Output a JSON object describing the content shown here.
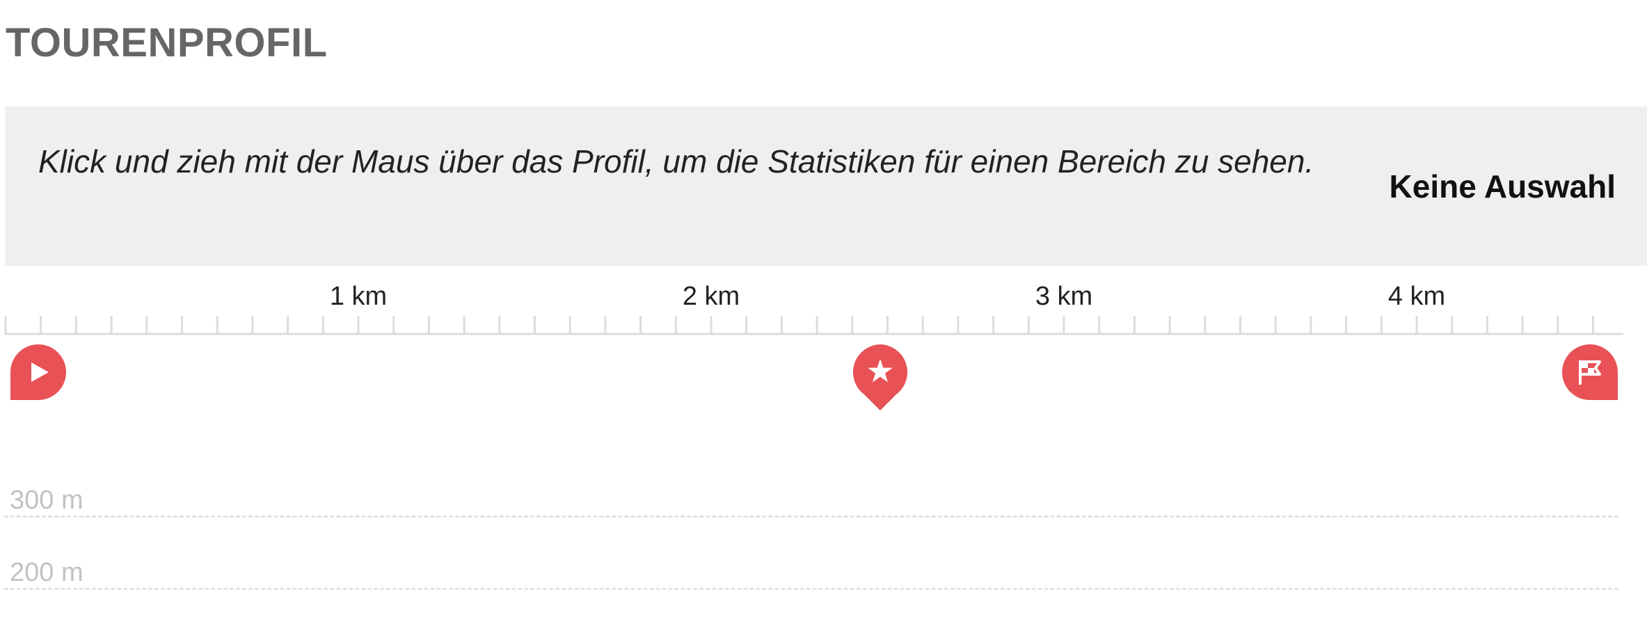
{
  "header": {
    "title": "TOURENPROFIL"
  },
  "info_box": {
    "hint": "Klick und zieh mit der Maus über das Profil, um die Statistiken für einen Bereich zu sehen.",
    "selection": "Keine Auswahl"
  },
  "distance_axis": {
    "labels": [
      "1 km",
      "2 km",
      "3 km",
      "4 km"
    ]
  },
  "markers": [
    {
      "icon": "start-play-icon",
      "label": "Start"
    },
    {
      "icon": "star-icon",
      "label": "Highlight"
    },
    {
      "icon": "finish-flag-icon",
      "label": "Ziel"
    }
  ],
  "elevation_axis": {
    "labels": [
      "300 m",
      "200 m"
    ]
  },
  "colors": {
    "accent": "#e85155",
    "title": "#666666",
    "panel": "#efefef"
  }
}
